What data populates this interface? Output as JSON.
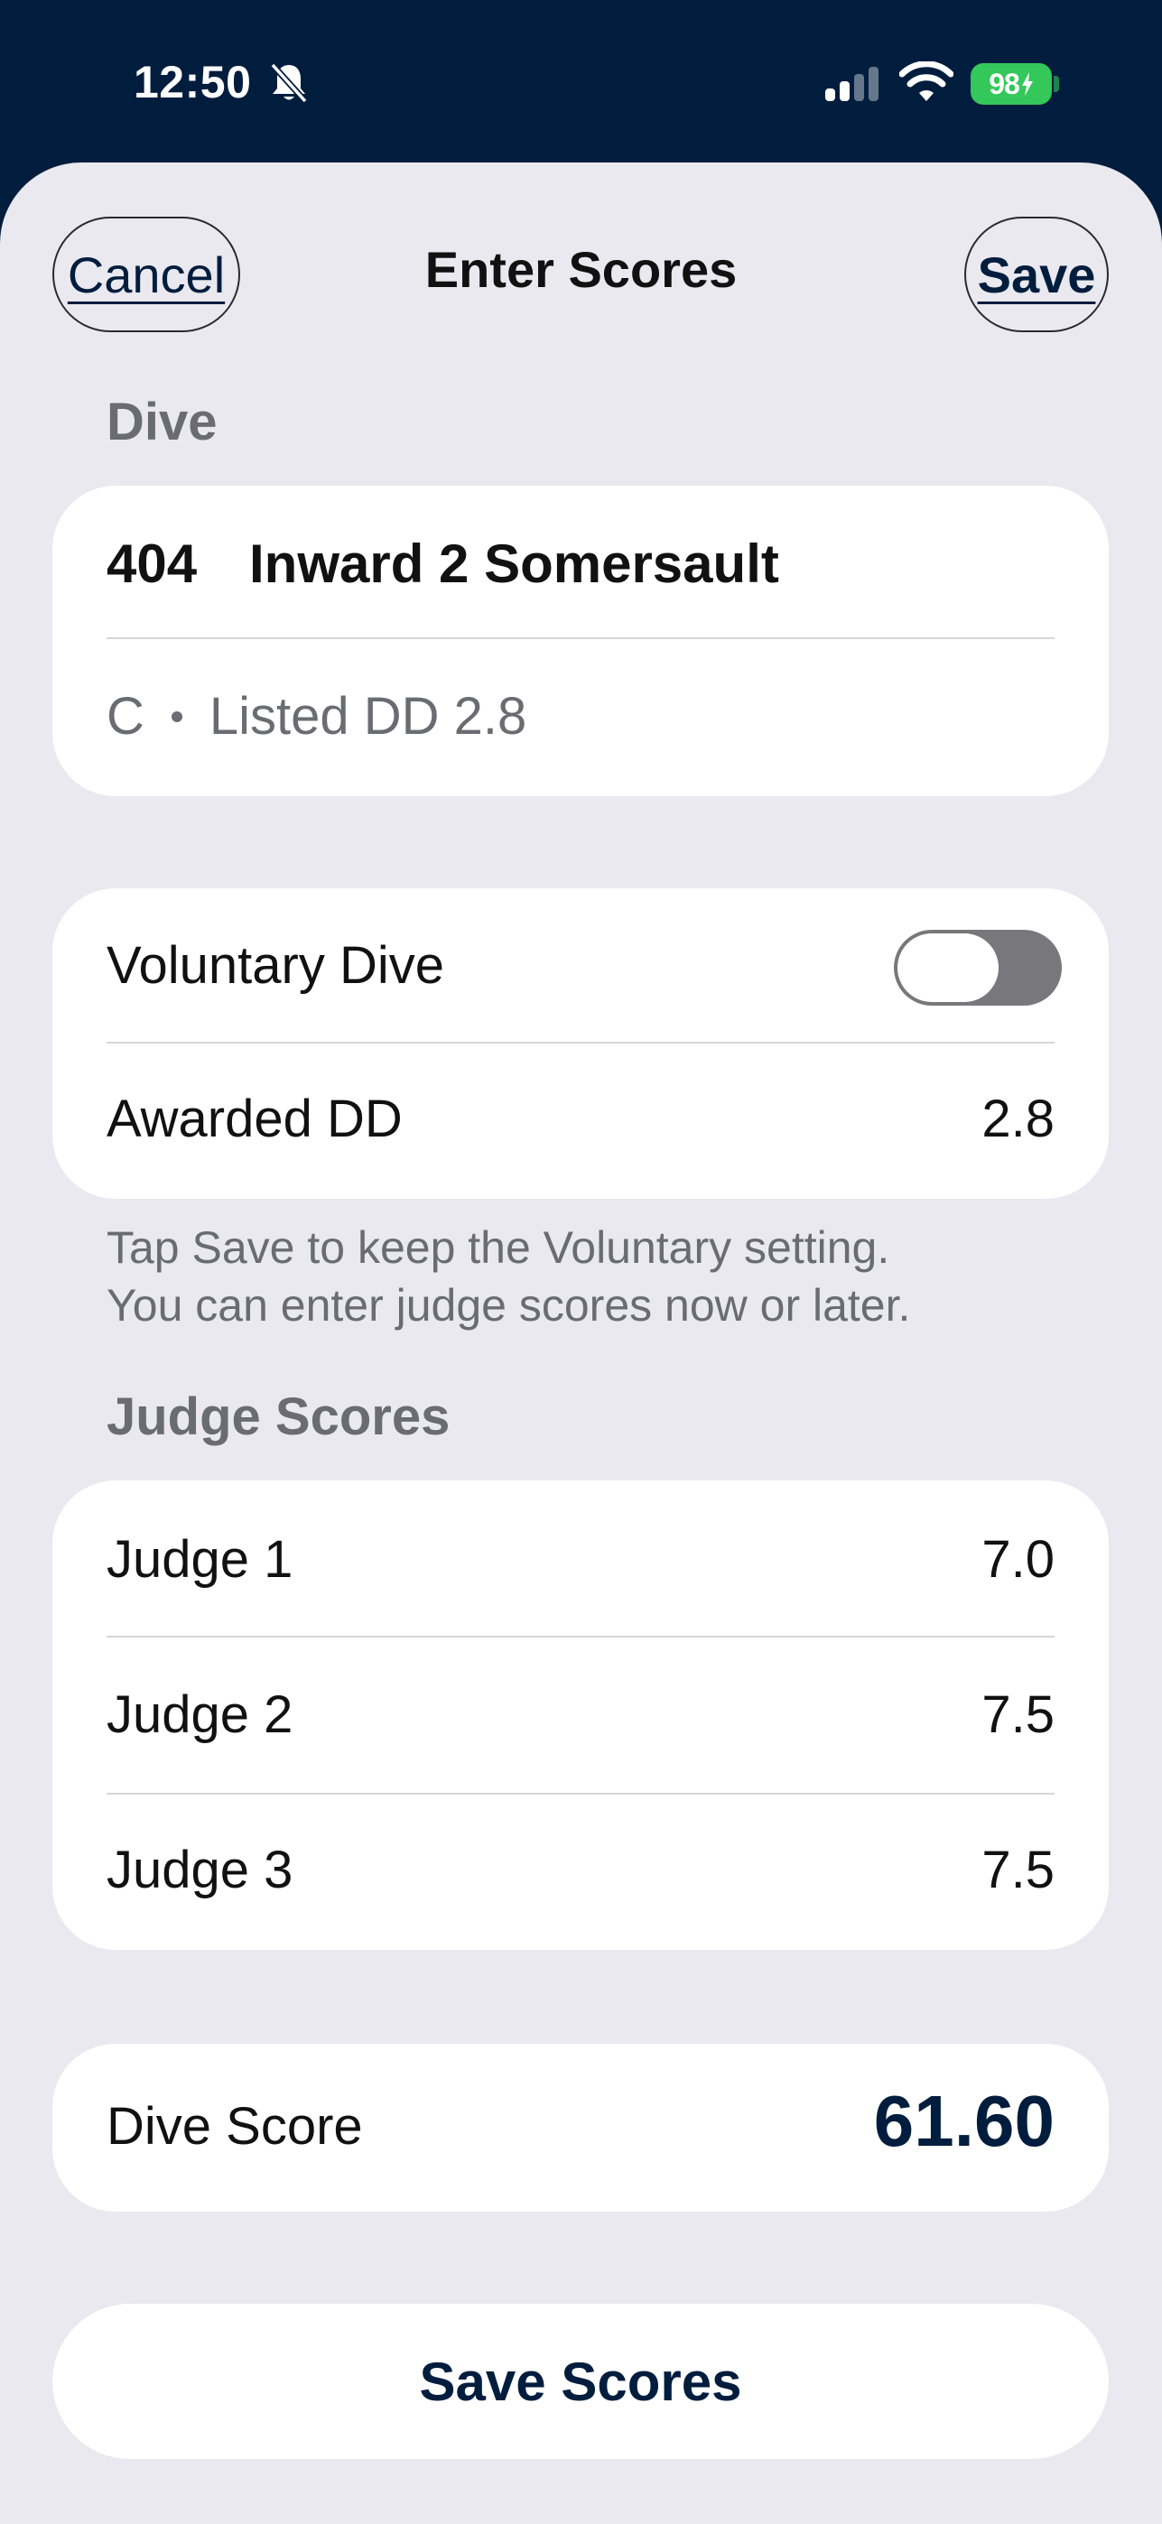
{
  "status_bar": {
    "time": "12:50",
    "battery": "98",
    "icons": [
      "bell-slash-icon",
      "cellular-signal-icon",
      "wifi-icon",
      "battery-charging-icon"
    ]
  },
  "nav": {
    "cancel_label": "Cancel",
    "title": "Enter Scores",
    "save_label": "Save"
  },
  "dive_section": {
    "header": "Dive",
    "code": "404",
    "name": "Inward 2 Somersault",
    "position": "C",
    "listed_dd": "Listed DD 2.8"
  },
  "settings": {
    "voluntary_label": "Voluntary Dive",
    "voluntary_on": false,
    "awarded_dd_label": "Awarded DD",
    "awarded_dd_value": "2.8",
    "footnote_line1": "Tap Save to keep the Voluntary setting.",
    "footnote_line2": "You can enter judge scores now or later."
  },
  "judges": {
    "header": "Judge Scores",
    "rows": [
      {
        "label": "Judge 1",
        "value": "7.0"
      },
      {
        "label": "Judge 2",
        "value": "7.5"
      },
      {
        "label": "Judge 3",
        "value": "7.5"
      }
    ]
  },
  "dive_score": {
    "label": "Dive Score",
    "value": "61.60"
  },
  "save_scores_label": "Save Scores",
  "colors": {
    "navy": "#011d3e",
    "background": "#e9e9ef",
    "battery_green": "#34c759",
    "secondary_text": "#6b6b72"
  }
}
